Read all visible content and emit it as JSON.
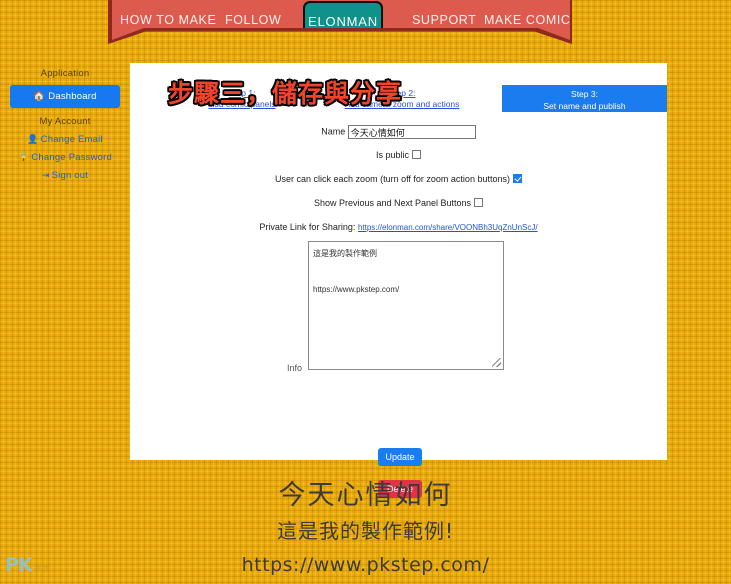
{
  "theme": {
    "background": "#e8a90a",
    "navbar_red": "#dd5a4e",
    "brand_teal": "#0e9289",
    "accent_blue": "#1b7cf0",
    "danger_red": "#dc3545",
    "link_blue": "#2b4fd8",
    "overlay_red": "#f2442c"
  },
  "navbar": {
    "brand": "ELONMAN",
    "links": [
      {
        "label": "HOW TO MAKE"
      },
      {
        "label": "FOLLOW"
      },
      {
        "label": "SUPPORT"
      },
      {
        "label": "MAKE COMIC"
      }
    ]
  },
  "sidebar": {
    "application_heading": "Application",
    "dashboard_label": "Dashboard",
    "dashboard_icon": "home-icon",
    "my_account_heading": "My Account",
    "items": [
      {
        "label": "Change Email",
        "icon": "user-icon"
      },
      {
        "label": "Change Password",
        "icon": "lock-icon"
      },
      {
        "label": "Sign out",
        "icon": "sign-out-icon"
      }
    ]
  },
  "steps": {
    "step1_line1": "Step 1:",
    "step1_line2": "Add comic panels",
    "step2_line1": "Step 2:",
    "step2_line2": "Add camera zoom and actions",
    "step3_line1": "Step 3:",
    "step3_line2": "Set name and publish"
  },
  "overlay": {
    "title": "步驟三，儲存與分享"
  },
  "form": {
    "name_label": "Name",
    "name_value": "今天心情如何",
    "name_placeholder": "",
    "is_public_label": "Is public",
    "is_public_checked": false,
    "user_click_zoom_label": "User can click each zoom (turn off for zoom action buttons)",
    "user_click_zoom_checked": true,
    "show_prev_next_label": "Show Previous and Next Panel Buttons",
    "show_prev_next_checked": false,
    "share_label": "Private Link for Sharing:",
    "share_url": "https://elonman.com/share/VOONBh3UqZnUnScJ/",
    "info_label": "Info",
    "info_value": "這是我的製作範例\n\nhttps://www.pkstep.com/",
    "info_placeholder": ""
  },
  "actions": {
    "update_label": "Update",
    "delete_label": "Delete"
  },
  "footer": {
    "title": "今天心情如何",
    "subtitle": "這是我的製作範例!",
    "url": "https://www.pkstep.com/"
  },
  "watermark": {
    "mark": "PK",
    "sub": "步步"
  }
}
